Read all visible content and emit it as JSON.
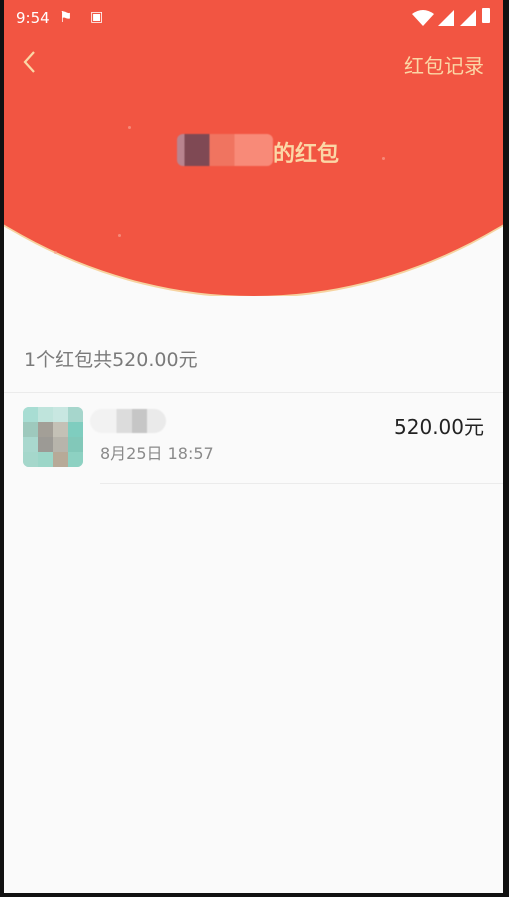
{
  "status_bar": {
    "time": "9:54"
  },
  "header": {
    "record_link": "红包记录",
    "title_suffix": "的红包"
  },
  "summary": {
    "text": "1个红包共520.00元"
  },
  "records": [
    {
      "time": "8月25日  18:57",
      "amount": "520.00元"
    }
  ],
  "colors": {
    "header_red": "#f25542",
    "gold_text": "#fbd7a6",
    "background": "#fafafa"
  }
}
